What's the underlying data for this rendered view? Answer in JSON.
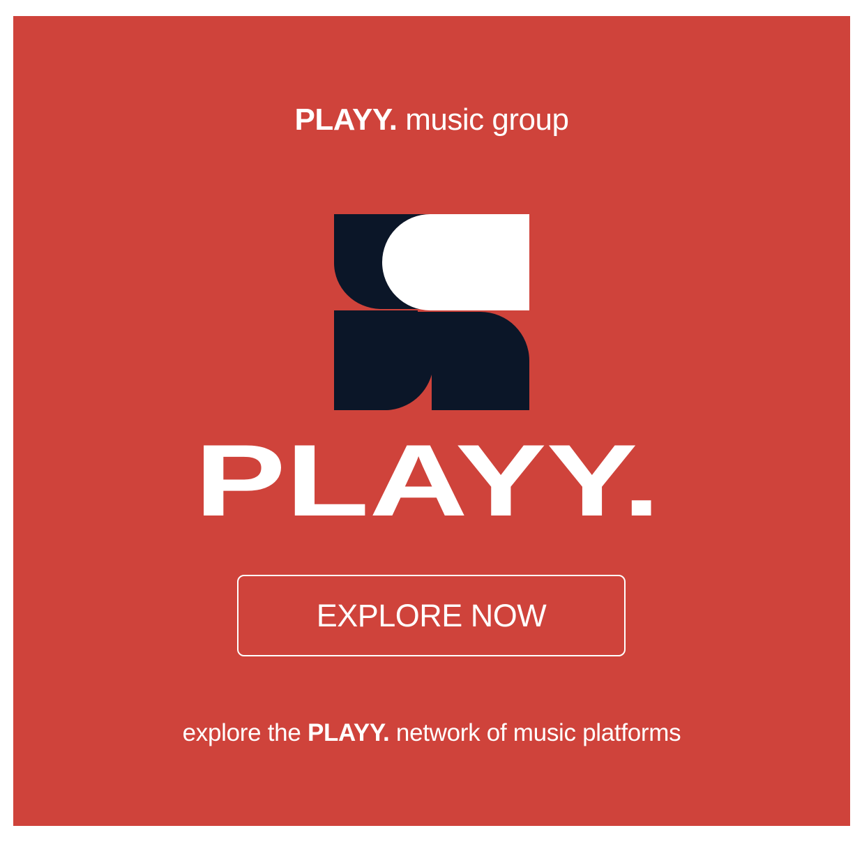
{
  "ad": {
    "brand": "PLAYY.",
    "group_suffix": "music group",
    "wordmark": "PLAYY.",
    "cta_label": "EXPLORE NOW",
    "tagline_prefix": "explore the",
    "tagline_brand": "PLAYY.",
    "tagline_suffix": "network of music platforms"
  },
  "colors": {
    "background": "#cf433b",
    "logo_dark": "#0b1628",
    "text": "#ffffff"
  },
  "icons": {
    "logo": "playy-logo-mark-icon"
  }
}
